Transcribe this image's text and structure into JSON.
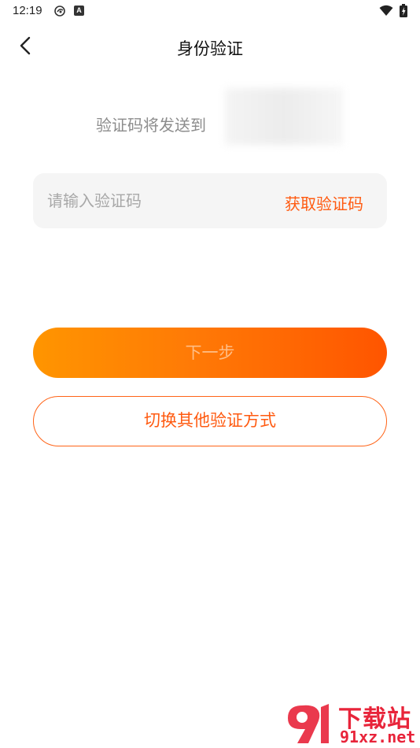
{
  "status_bar": {
    "time": "12:19",
    "notification_letter": "A",
    "icons": [
      "cloud-notification-icon",
      "text-notification-icon",
      "wifi-icon",
      "battery-charging-icon"
    ]
  },
  "header": {
    "title": "身份验证",
    "back_icon": "chevron-left-icon"
  },
  "verification": {
    "send_to_label": "验证码将发送到",
    "code_input_placeholder": "请输入验证码",
    "code_input_value": "",
    "get_code_label": "获取验证码"
  },
  "actions": {
    "next_label": "下一步",
    "switch_method_label": "切换其他验证方式"
  },
  "colors": {
    "accent": "#ff5a10",
    "gradient_start": "#ff9500",
    "gradient_end": "#ff5500",
    "input_background": "#f5f5f5",
    "watermark": "#e8243a"
  },
  "watermark": {
    "cn_text": "下载站",
    "en_text": "91xz.net"
  }
}
